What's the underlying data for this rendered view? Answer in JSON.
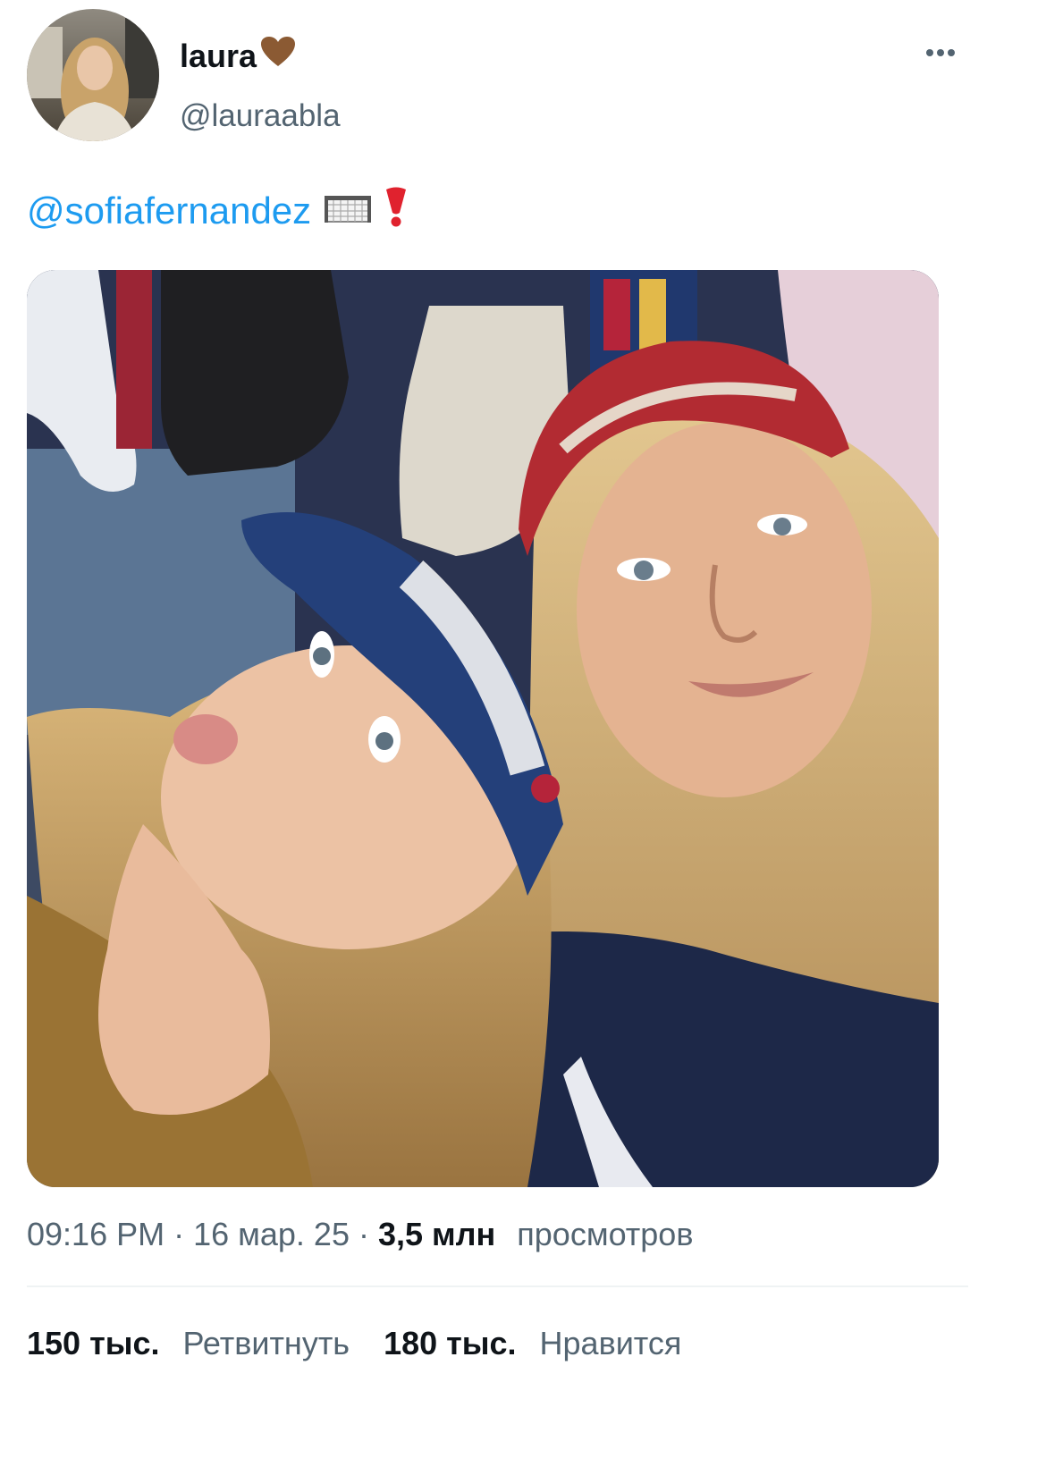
{
  "tweet": {
    "display_name": "laura",
    "name_emoji": "brown-heart-icon",
    "handle": "@lauraabla",
    "mention": "@sofiafernandez",
    "emojis": [
      "goal-net-icon",
      "heavy-exclamation-mark-icon"
    ],
    "time": "09:16 PM",
    "date": "16 мар. 25",
    "separator": "·",
    "views_count": "3,5 млн",
    "views_label": "просмотров"
  },
  "stats": {
    "retweets_count": "150 тыс.",
    "retweets_label": "Ретвитнуть",
    "likes_count": "180 тыс.",
    "likes_label": "Нравится"
  },
  "colors": {
    "mention": "#1d9bf0",
    "secondary_text": "#536471",
    "primary_text": "#0f1419",
    "divider": "#eff3f4"
  },
  "photo": {
    "description_icon": "photo-two-women-in-caps-at-stadium"
  }
}
